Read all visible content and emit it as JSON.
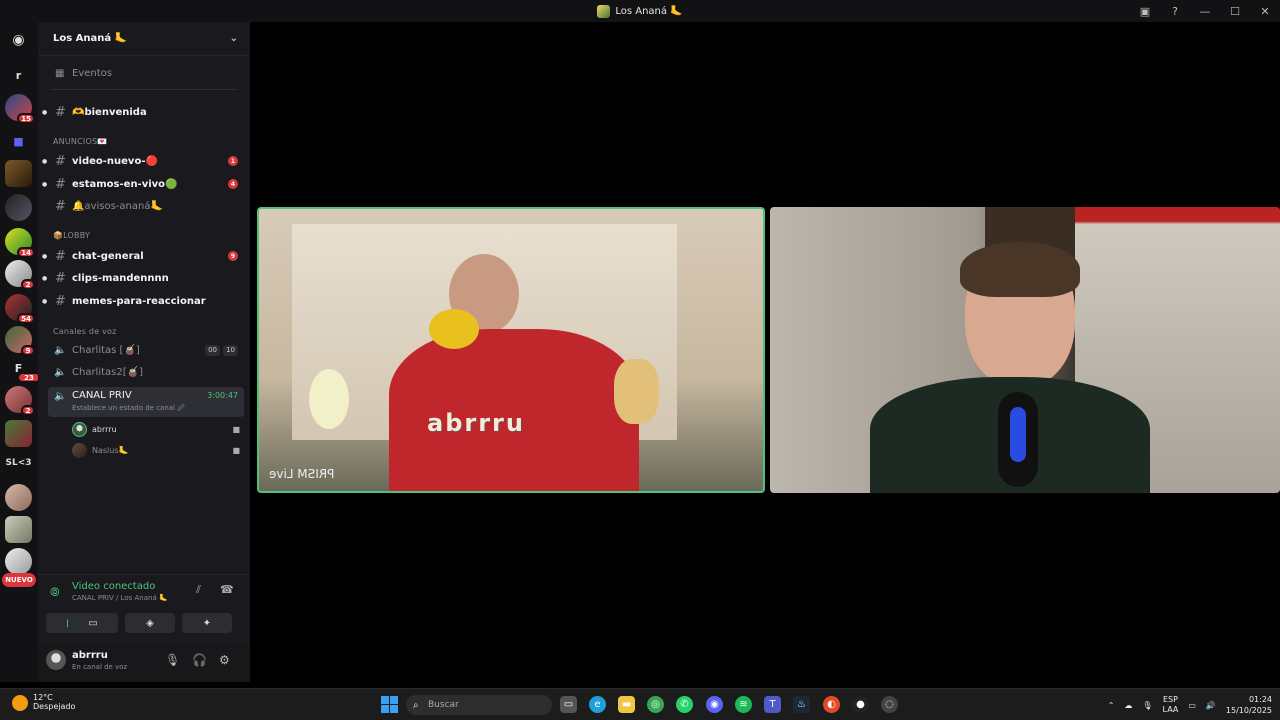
{
  "window": {
    "title": "Los Ananá 🦶"
  },
  "server": {
    "name": "Los Ananá 🦶"
  },
  "rail": {
    "letters": [
      "r",
      "F",
      "SL<3"
    ],
    "badges": [
      "15",
      "14",
      "2",
      "54",
      "9",
      "23",
      "2"
    ],
    "nuevo": "NUEVO"
  },
  "channels": {
    "events": "Eventos",
    "bienvenida": "🫶bienvenida",
    "anuncios_cat": "ANUNCIOS💌",
    "video_nuevo": "video-nuevo-🔴",
    "video_nuevo_ping": "1",
    "estamos": "estamos-en-vivo🟢",
    "estamos_ping": "4",
    "avisos": "🔔avisos-ananá🦶",
    "lobby_cat": "📦LOBBY",
    "chat_general": "chat-general",
    "chat_general_ping": "9",
    "clips": "clips-mandennnn",
    "memes": "memes-para-reaccionar",
    "voice_cat": "Canales de voz",
    "charlitas": "Charlitas [🧉]",
    "charlitas_a": "00",
    "charlitas_b": "10",
    "charlitas2": "Charlitas2[🧉]",
    "canal_priv": "CANAL PRIV",
    "canal_priv_timer": "3:00:47",
    "canal_priv_status": "Establece un estado de canal 🖉",
    "members": [
      "abrrru",
      "Naslus🦶"
    ]
  },
  "voice_panel": {
    "title": "Video conectado",
    "subtitle": "CANAL PRIV / Los Ananá 🦶"
  },
  "user": {
    "name": "abrrru",
    "status": "En canal de voz"
  },
  "stage": {
    "tile1_overlay": "abrrru",
    "tile1_watermark": "PRISM Live"
  },
  "taskbar": {
    "temp": "12°C",
    "weather": "Despejado",
    "search_placeholder": "Buscar",
    "lang": "ESP",
    "lang_sub": "LAA",
    "time": "01:24",
    "date": "15/10/2025"
  }
}
